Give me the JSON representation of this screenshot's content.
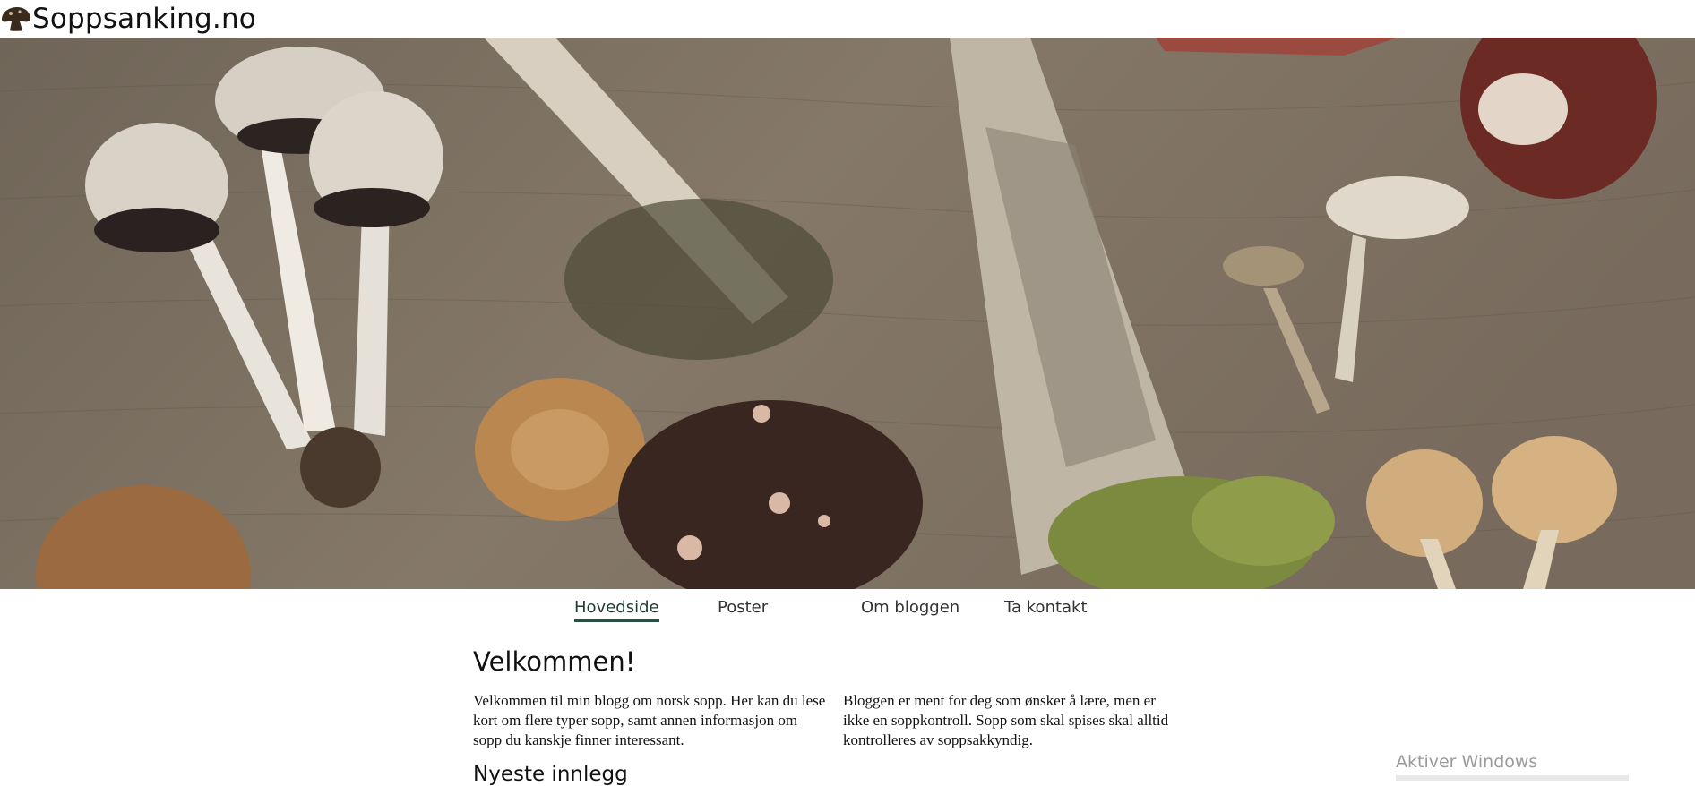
{
  "header": {
    "title": "Soppsanking.no",
    "logo_icon": "mushroom-icon"
  },
  "hero": {
    "image": "mushrooms-on-wooden-table-photo"
  },
  "nav": {
    "items": [
      {
        "label": "Hovedside",
        "active": true
      },
      {
        "label": "Poster",
        "active": false
      },
      {
        "label": "Om bloggen",
        "active": false
      },
      {
        "label": "Ta kontakt",
        "active": false
      }
    ]
  },
  "main": {
    "welcome_title": "Velkommen!",
    "left_text": "Velkommen til min blogg om norsk sopp. Her kan du lese kort om flere typer sopp, samt annen informasjon om sopp du kanskje finner interessant.",
    "right_text": "Bloggen er ment for deg som ønsker å lære, men er ikke en soppkontroll. Sopp som skal spises skal alltid kontrolleres av soppsakkyndig.",
    "latest_title": "Nyeste innlegg"
  },
  "overlay": {
    "activate_windows": "Aktiver Windows"
  },
  "colors": {
    "nav_active": "#2c4f45",
    "wood": "#7d7062"
  }
}
